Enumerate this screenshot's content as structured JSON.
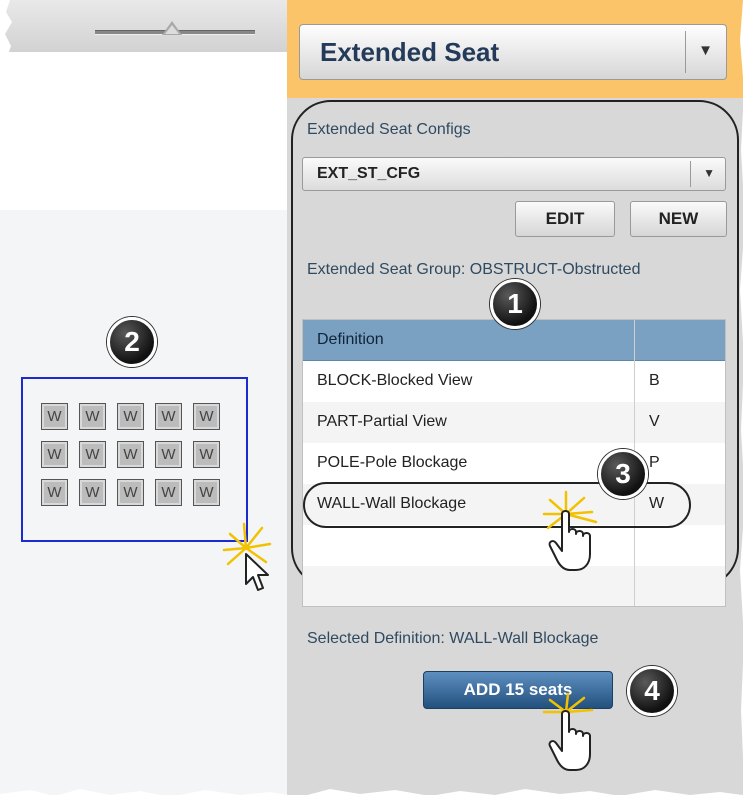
{
  "header": {
    "dropdown_value": "Extended Seat",
    "dropdown_arrow": "▼"
  },
  "configs": {
    "label": "Extended Seat Configs",
    "dropdown_value": "EXT_ST_CFG",
    "dropdown_arrow": "▼",
    "edit_label": "EDIT",
    "new_label": "NEW"
  },
  "group_label": "Extended Seat Group: OBSTRUCT-Obstructed",
  "table": {
    "header": "Definition",
    "rows": [
      {
        "definition": "BLOCK-Blocked View",
        "code": "B"
      },
      {
        "definition": "PART-Partial View",
        "code": "V"
      },
      {
        "definition": "POLE-Pole Blockage",
        "code": "P"
      },
      {
        "definition": "WALL-Wall Blockage",
        "code": "W"
      }
    ]
  },
  "selected_definition": "Selected Definition: WALL-Wall Blockage",
  "add_button": "ADD 15 seats",
  "callouts": [
    "1",
    "2",
    "3",
    "4"
  ],
  "seat_grid": {
    "rows": 3,
    "cols": 5,
    "label": "W"
  },
  "colors": {
    "header_accent": "#fbc468",
    "table_header": "#7aa0c2",
    "add_button": "#2f6496",
    "selection_box": "#1c2bd0"
  },
  "icons": [
    "slider-thumb-icon",
    "dropdown-arrow-icon",
    "hand-pointer-icon",
    "arrow-cursor-icon",
    "click-burst-icon"
  ]
}
